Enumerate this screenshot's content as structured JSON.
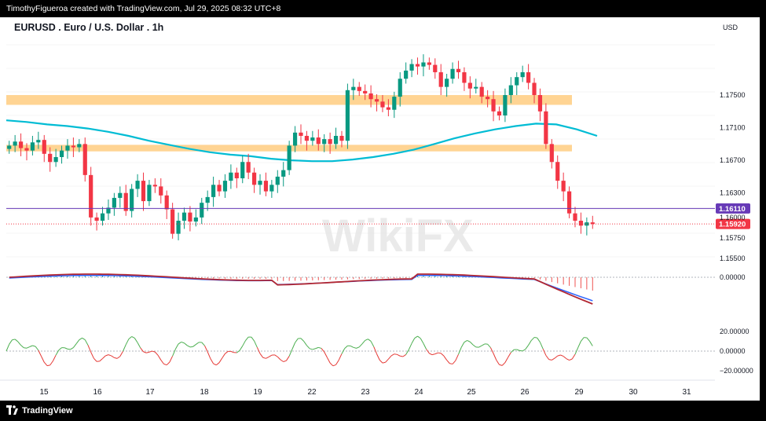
{
  "header": {
    "credit": "TimothyFigueroa created with TradingView.com, Jul 29, 2025 08:32 UTC+8"
  },
  "footer": {
    "brand": "TradingView"
  },
  "chart_data": {
    "type": "candlestick",
    "symbol": "EURUSD . Euro / U.S. Dollar . 1h",
    "currency": "USD",
    "watermark": "WikiFX",
    "price_axis": {
      "ylim": [
        1.1545,
        1.1828
      ],
      "ticks": [
        "1.17500",
        "1.17100",
        "1.16700",
        "1.16300",
        "1.16000",
        "1.15750",
        "1.15500"
      ]
    },
    "x_axis": {
      "ticks": [
        "15",
        "16",
        "17",
        "18",
        "19",
        "22",
        "23",
        "24",
        "25",
        "26",
        "29",
        "30",
        "31"
      ]
    },
    "badges": [
      {
        "label": "1.16110",
        "value": 1.1611,
        "color": "#673ab7"
      },
      {
        "label": "1.15920",
        "value": 1.1592,
        "color": "#f23645"
      }
    ],
    "zones": [
      {
        "low": 1.1738,
        "high": 1.175,
        "color": "#ffcc80"
      },
      {
        "low": 1.1681,
        "high": 1.1689,
        "color": "#ffcc80"
      }
    ],
    "ohlc_close_path": [
      1.1688,
      1.1693,
      1.1685,
      1.1682,
      1.1692,
      1.1695,
      1.1678,
      1.1668,
      1.1674,
      1.1682,
      1.1688,
      1.1686,
      1.169,
      1.1652,
      1.16,
      1.1596,
      1.1605,
      1.1612,
      1.1624,
      1.163,
      1.1608,
      1.1635,
      1.1645,
      1.162,
      1.164,
      1.1638,
      1.1627,
      1.161,
      1.158,
      1.1596,
      1.1606,
      1.1595,
      1.16,
      1.1618,
      1.1625,
      1.164,
      1.1632,
      1.1645,
      1.1655,
      1.1648,
      1.1668,
      1.1655,
      1.164,
      1.1645,
      1.1632,
      1.164,
      1.165,
      1.1658,
      1.1688,
      1.1704,
      1.17,
      1.1694,
      1.1698,
      1.169,
      1.1696,
      1.169,
      1.17,
      1.1694,
      1.1756,
      1.176,
      1.1755,
      1.1752,
      1.1745,
      1.1742,
      1.1735,
      1.1732,
      1.1748,
      1.177,
      1.178,
      1.1788,
      1.1785,
      1.179,
      1.1787,
      1.1778,
      1.176,
      1.177,
      1.1782,
      1.1778,
      1.1765,
      1.1758,
      1.176,
      1.1748,
      1.1745,
      1.173,
      1.1725,
      1.175,
      1.1762,
      1.1772,
      1.1778,
      1.1765,
      1.175,
      1.173,
      1.169,
      1.1668,
      1.1645,
      1.1632,
      1.1605,
      1.1596,
      1.159,
      1.1594,
      1.1592
    ],
    "ma_path": [
      1.1719,
      1.1717,
      1.1714,
      1.1712,
      1.1709,
      1.1705,
      1.17,
      1.1694,
      1.1689,
      1.1684,
      1.168,
      1.1677,
      1.1675,
      1.1672,
      1.167,
      1.1669,
      1.1669,
      1.1671,
      1.1674,
      1.1678,
      1.1683,
      1.169,
      1.1697,
      1.1703,
      1.1708,
      1.1712,
      1.1715,
      1.1714,
      1.1708,
      1.17
    ],
    "macd": {
      "zero_label": "0.00000"
    },
    "oscillator": {
      "ticks": [
        "20.00000",
        "0.00000",
        "−20.00000"
      ]
    }
  }
}
